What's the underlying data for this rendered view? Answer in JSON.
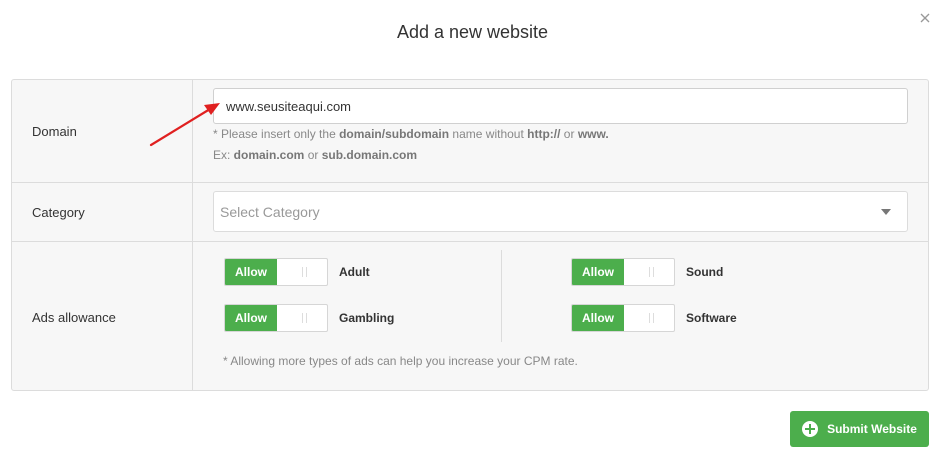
{
  "modal": {
    "title": "Add a new website"
  },
  "domain": {
    "label": "Domain",
    "input_value": "www.seusiteaqui.com",
    "hint1_pre": "* Please insert only the ",
    "hint1_b1": "domain/subdomain",
    "hint1_mid": " name without ",
    "hint1_b2": "http://",
    "hint1_or": " or ",
    "hint1_b3": "www.",
    "hint2_pre": "Ex: ",
    "hint2_b1": "domain.com",
    "hint2_or": " or ",
    "hint2_b2": "sub.domain.com"
  },
  "category": {
    "label": "Category",
    "placeholder": "Select Category"
  },
  "ads": {
    "label": "Ads allowance",
    "items": [
      {
        "toggle_label": "Allow",
        "name": "Adult"
      },
      {
        "toggle_label": "Allow",
        "name": "Gambling"
      },
      {
        "toggle_label": "Allow",
        "name": "Sound"
      },
      {
        "toggle_label": "Allow",
        "name": "Software"
      }
    ],
    "note": "* Allowing more types of ads can help you increase your CPM rate."
  },
  "submit": {
    "label": "Submit Website"
  },
  "colors": {
    "accent": "#4cae4c",
    "annotation_arrow": "#e02020"
  }
}
